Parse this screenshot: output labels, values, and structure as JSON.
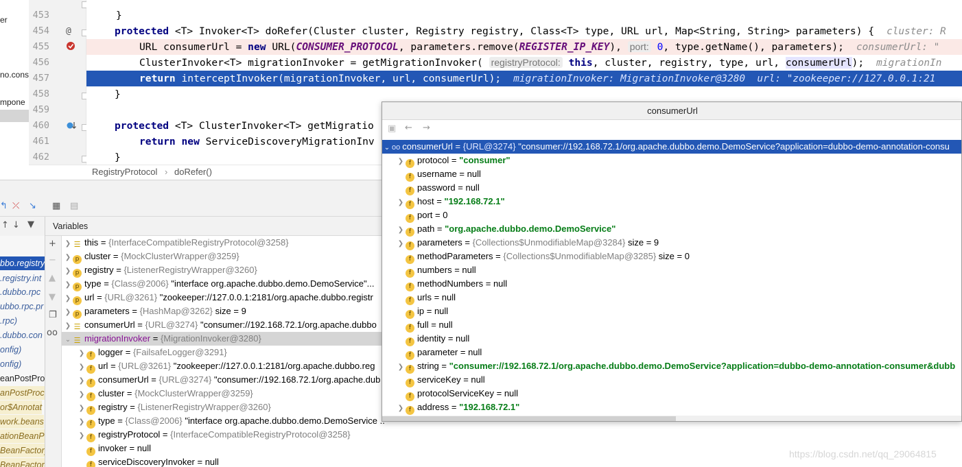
{
  "project_strip": [
    "er",
    "no.cons",
    "mpone"
  ],
  "editor": {
    "line_numbers": [
      "453",
      "454",
      "455",
      "456",
      "457",
      "458",
      "459",
      "460",
      "461",
      "462"
    ],
    "lines": {
      "l453": "}",
      "l454_a": "protected",
      "l454_b": " <T> Invoker<T> doRefer(Cluster cluster, Registry registry, Class<T> type, URL url, Map<String, String> parameters) {",
      "l454_hint": "cluster: R",
      "l455_a": "URL ",
      "l455_b": "consumerUrl",
      "l455_c": " = ",
      "l455_d": "new",
      "l455_e": " URL(",
      "l455_f": "CONSUMER_PROTOCOL",
      "l455_g": ", parameters.remove(",
      "l455_h": "REGISTER_IP_KEY",
      "l455_i": "),",
      "l455_j": "port:",
      "l455_k": "0",
      "l455_l": ", type.getName(), parameters);",
      "l455_hint": "consumerUrl: \"",
      "l456_a": "ClusterInvoker<T> migrationInvoker = getMigrationInvoker(",
      "l456_b": "registryProtocol:",
      "l456_c": "this",
      "l456_d": ", cluster, registry, type, url, ",
      "l456_e": "consumerUrl",
      "l456_f": ");",
      "l456_hint": "migrationIn",
      "l457_a": "return",
      "l457_b": " interceptInvoker(migrationInvoker, url, consumerUrl);",
      "l457_hint": "migrationInvoker: MigrationInvoker@3280  url: \"zookeeper://127.0.0.1:21",
      "l458": "}",
      "l460_a": "protected",
      "l460_b": " <T> ClusterInvoker<T> getMigratio",
      "l461_a": "return",
      "l461_b": "new",
      "l461_c": " ServiceDiscoveryMigrationInv",
      "l462": "}"
    }
  },
  "breadcrumb": {
    "class_name": "RegistryProtocol",
    "sep": "›",
    "method": "doRefer()"
  },
  "debugger": {
    "vars_title": "Variables",
    "frames": [
      "bbo.registry",
      ".registry.int",
      ".dubbo.rpc",
      "ubbo.rpc.pr",
      ".rpc)",
      ".dubbo.con",
      "onfig)",
      "onfig)",
      "eanPostPro",
      "anPostProces",
      "or$Annotat",
      "work.beans",
      "ationBeanP",
      "BeanFactory",
      "BeanFactory"
    ],
    "variables": [
      {
        "icon": "list",
        "name": "this",
        "type": "{InterfaceCompatibleRegistryProtocol@3258}",
        "value": "",
        "arrow": "❯"
      },
      {
        "icon": "p",
        "name": "cluster",
        "type": "{MockClusterWrapper@3259}",
        "value": "",
        "arrow": "❯"
      },
      {
        "icon": "p",
        "name": "registry",
        "type": "{ListenerRegistryWrapper@3260}",
        "value": "",
        "arrow": "❯"
      },
      {
        "icon": "p",
        "name": "type",
        "type": "{Class@2006}",
        "value": "\"interface org.apache.dubbo.demo.DemoService\"...",
        "arrow": "❯"
      },
      {
        "icon": "p",
        "name": "url",
        "type": "{URL@3261}",
        "value": "\"zookeeper://127.0.0.1:2181/org.apache.dubbo.registr",
        "arrow": "❯"
      },
      {
        "icon": "p",
        "name": "parameters",
        "type": "{HashMap@3262}",
        "value": "size = 9",
        "arrow": "❯"
      },
      {
        "icon": "list",
        "name": "consumerUrl",
        "type": "{URL@3274}",
        "value": "\"consumer://192.168.72.1/org.apache.dubbo",
        "arrow": "❯"
      },
      {
        "icon": "list",
        "name": "migrationInvoker",
        "type": "{MigrationInvoker@3280}",
        "value": "",
        "arrow": "⌄"
      },
      {
        "icon": "f",
        "name": "logger",
        "type": "{FailsafeLogger@3291}",
        "value": "",
        "arrow": "❯"
      },
      {
        "icon": "f",
        "name": "url",
        "type": "{URL@3261}",
        "value": "\"zookeeper://127.0.0.1:2181/org.apache.dubbo.reg",
        "arrow": "❯"
      },
      {
        "icon": "f",
        "name": "consumerUrl",
        "type": "{URL@3274}",
        "value": "\"consumer://192.168.72.1/org.apache.dub",
        "arrow": "❯"
      },
      {
        "icon": "f",
        "name": "cluster",
        "type": "{MockClusterWrapper@3259}",
        "value": "",
        "arrow": "❯"
      },
      {
        "icon": "f",
        "name": "registry",
        "type": "{ListenerRegistryWrapper@3260}",
        "value": "",
        "arrow": "❯"
      },
      {
        "icon": "f",
        "name": "type",
        "type": "{Class@2006}",
        "value": "\"interface org.apache.dubbo.demo.DemoService ... Navigate",
        "arrow": "❯"
      },
      {
        "icon": "f",
        "name": "registryProtocol",
        "type": "{InterfaceCompatibleRegistryProtocol@3258}",
        "value": "",
        "arrow": "❯"
      },
      {
        "icon": "f",
        "name": "invoker",
        "type": "",
        "value": "null",
        "arrow": ""
      },
      {
        "icon": "f",
        "name": "serviceDiscoveryInvoker",
        "type": "",
        "value": "null",
        "arrow": ""
      }
    ]
  },
  "popup": {
    "title": "consumerUrl",
    "root": {
      "name": "consumerUrl",
      "type": "{URL@3274}",
      "value": "\"consumer://192.168.72.1/org.apache.dubbo.demo.DemoService?application=dubbo-demo-annotation-consu"
    },
    "fields": [
      {
        "name": "protocol",
        "type": "",
        "value": "\"consumer\"",
        "kind": "str",
        "arrow": "❯"
      },
      {
        "name": "username",
        "type": "",
        "value": "null",
        "kind": "plain",
        "arrow": ""
      },
      {
        "name": "password",
        "type": "",
        "value": "null",
        "kind": "plain",
        "arrow": ""
      },
      {
        "name": "host",
        "type": "",
        "value": "\"192.168.72.1\"",
        "kind": "str",
        "arrow": "❯"
      },
      {
        "name": "port",
        "type": "",
        "value": "0",
        "kind": "plain",
        "arrow": ""
      },
      {
        "name": "path",
        "type": "",
        "value": "\"org.apache.dubbo.demo.DemoService\"",
        "kind": "str",
        "arrow": "❯"
      },
      {
        "name": "parameters",
        "type": "{Collections$UnmodifiableMap@3284}",
        "value": "size = 9",
        "kind": "plain",
        "arrow": "❯"
      },
      {
        "name": "methodParameters",
        "type": "{Collections$UnmodifiableMap@3285}",
        "value": "size = 0",
        "kind": "plain",
        "arrow": ""
      },
      {
        "name": "numbers",
        "type": "",
        "value": "null",
        "kind": "plain",
        "arrow": ""
      },
      {
        "name": "methodNumbers",
        "type": "",
        "value": "null",
        "kind": "plain",
        "arrow": ""
      },
      {
        "name": "urls",
        "type": "",
        "value": "null",
        "kind": "plain",
        "arrow": ""
      },
      {
        "name": "ip",
        "type": "",
        "value": "null",
        "kind": "plain",
        "arrow": ""
      },
      {
        "name": "full",
        "type": "",
        "value": "null",
        "kind": "plain",
        "arrow": ""
      },
      {
        "name": "identity",
        "type": "",
        "value": "null",
        "kind": "plain",
        "arrow": ""
      },
      {
        "name": "parameter",
        "type": "",
        "value": "null",
        "kind": "plain",
        "arrow": ""
      },
      {
        "name": "string",
        "type": "",
        "value": "\"consumer://192.168.72.1/org.apache.dubbo.demo.DemoService?application=dubbo-demo-annotation-consumer&dubb",
        "kind": "str",
        "arrow": "❯"
      },
      {
        "name": "serviceKey",
        "type": "",
        "value": "null",
        "kind": "plain",
        "arrow": ""
      },
      {
        "name": "protocolServiceKey",
        "type": "",
        "value": "null",
        "kind": "plain",
        "arrow": ""
      },
      {
        "name": "address",
        "type": "",
        "value": "\"192.168.72.1\"",
        "kind": "str",
        "arrow": "❯"
      }
    ]
  },
  "watermark": "https://blog.csdn.net/qq_29064815"
}
